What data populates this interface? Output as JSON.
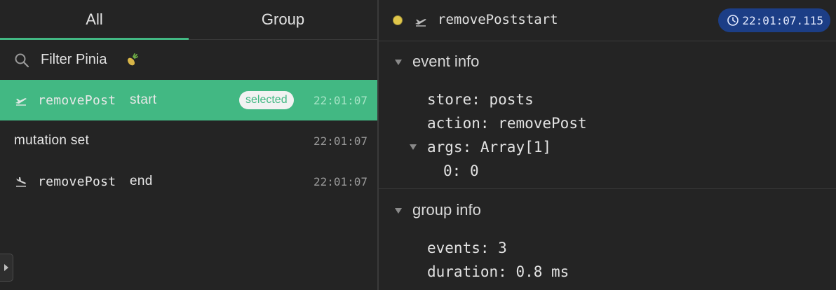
{
  "tabs": [
    {
      "label": "All",
      "active": true
    },
    {
      "label": "Group",
      "active": false
    }
  ],
  "filter": {
    "placeholder": "Filter Pinia",
    "icon": "pineapple-icon"
  },
  "events": [
    {
      "name": "removePost",
      "suffix": "start",
      "time": "22:01:07",
      "selected": true,
      "badge": "selected",
      "icon": "plane-takeoff-icon"
    },
    {
      "name": "mutation set",
      "suffix": "",
      "time": "22:01:07",
      "selected": false,
      "badge": "",
      "icon": ""
    },
    {
      "name": "removePost",
      "suffix": "end",
      "time": "22:01:07",
      "selected": false,
      "badge": "",
      "icon": "plane-landing-icon"
    }
  ],
  "detail": {
    "title": "removePoststart",
    "timestamp": "22:01:07.115",
    "event_info": {
      "title": "event info",
      "store_key": "store:",
      "store_val": "posts",
      "action_key": "action:",
      "action_val": "removePost",
      "args_key": "args:",
      "args_val": "Array[1]",
      "arg0_key": "0:",
      "arg0_val": "0"
    },
    "group_info": {
      "title": "group info",
      "events_key": "events:",
      "events_val": "3",
      "duration_key": "duration:",
      "duration_val": "0.8 ms"
    }
  },
  "colors": {
    "accent": "#42b883",
    "pill": "#1c3e86",
    "dot": "#e0c64a"
  }
}
